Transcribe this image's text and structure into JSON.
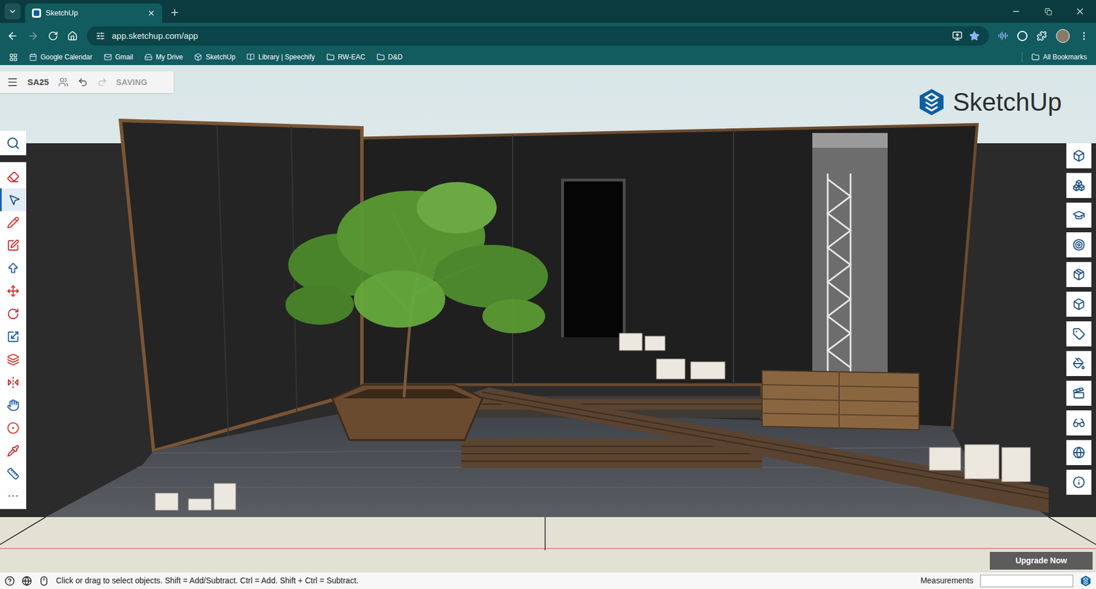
{
  "browser": {
    "tab": {
      "title": "SketchUp",
      "selected": true
    },
    "url": "app.sketchup.com/app",
    "bookmarks": [
      {
        "label": "Google Calendar",
        "kind": "calendar"
      },
      {
        "label": "Gmail",
        "kind": "mail"
      },
      {
        "label": "My Drive",
        "kind": "drive"
      },
      {
        "label": "SketchUp",
        "kind": "sketchup"
      },
      {
        "label": "Library | Speechify",
        "kind": "speechify"
      },
      {
        "label": "RW-EAC",
        "kind": "folder"
      },
      {
        "label": "D&D",
        "kind": "folder"
      }
    ],
    "all_bookmarks": "All Bookmarks"
  },
  "app": {
    "file_name": "SA25",
    "save_status": "SAVING",
    "redo_disabled": true,
    "logo": "SketchUp",
    "tools": [
      {
        "selected": false
      },
      {
        "selected": true
      },
      {
        "selected": false
      },
      {
        "selected": false
      },
      {
        "selected": false
      },
      {
        "selected": false
      },
      {
        "selected": false
      },
      {
        "selected": false
      },
      {
        "selected": false
      },
      {
        "selected": false
      },
      {
        "selected": false
      },
      {
        "selected": false
      },
      {
        "selected": false
      },
      {
        "selected": false
      }
    ],
    "more_tools": "⋯",
    "upgrade_button": "Upgrade Now"
  },
  "status_bar": {
    "hint": "Click or drag to select objects. Shift = Add/Subtract. Ctrl = Add. Shift + Ctrl = Subtract.",
    "measurements_label": "Measurements",
    "measurements_value": ""
  }
}
